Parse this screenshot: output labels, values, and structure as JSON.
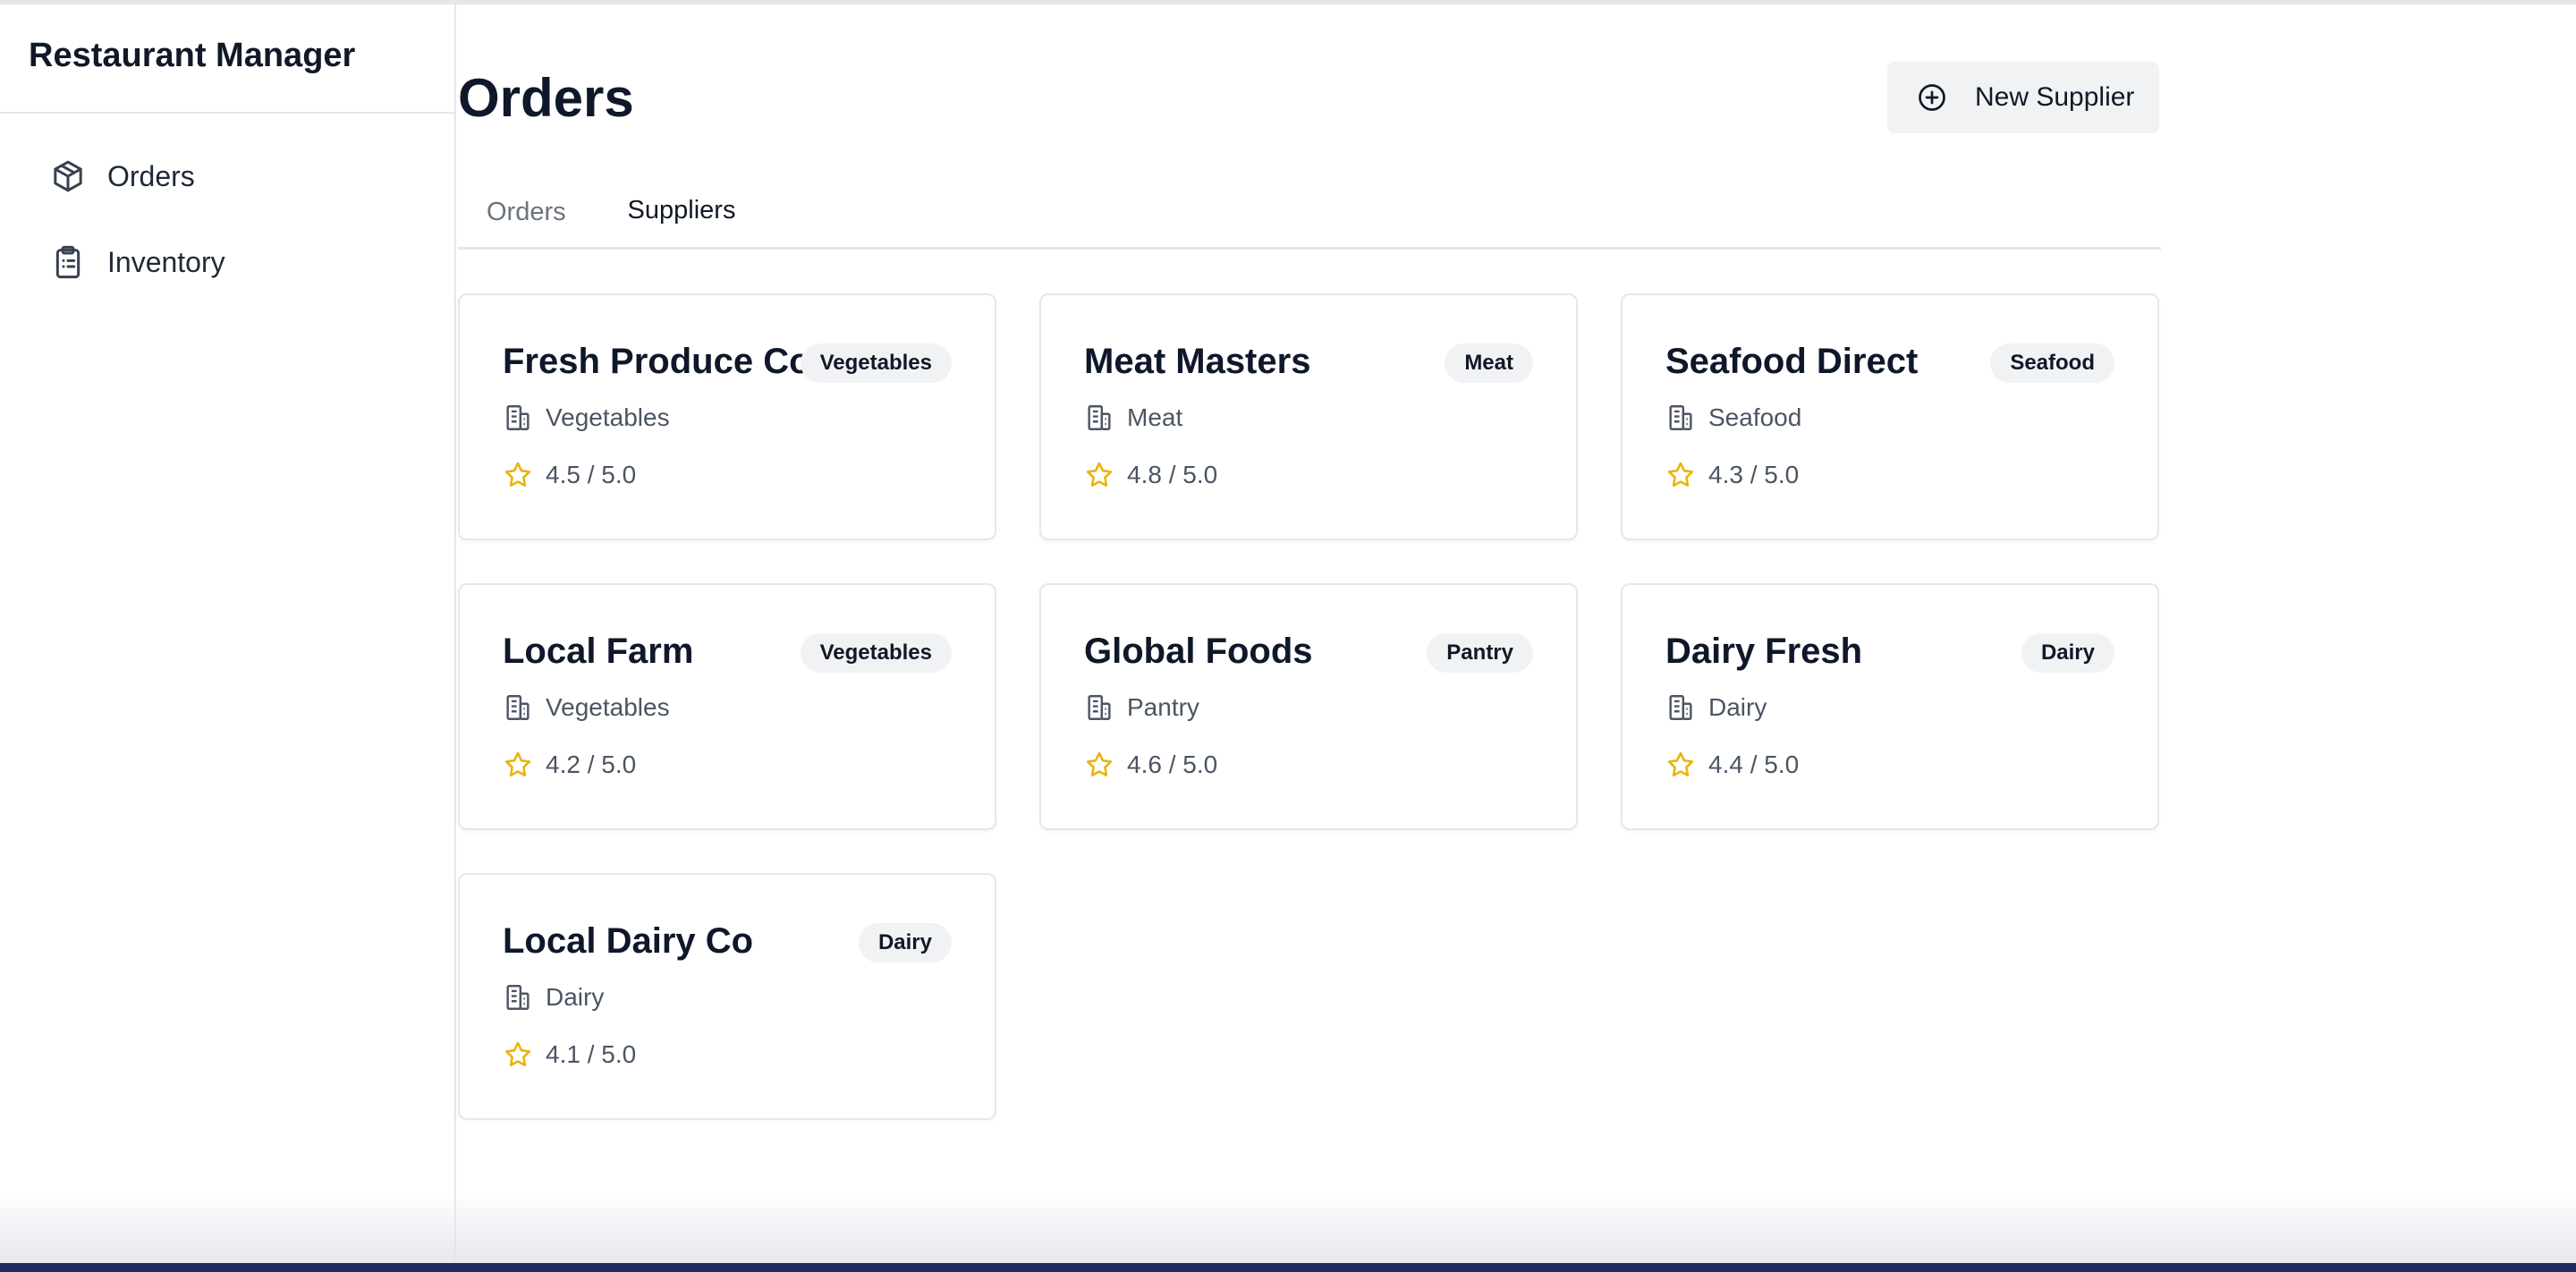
{
  "app": {
    "title": "Restaurant Manager"
  },
  "sidebar": {
    "items": [
      {
        "label": "Orders",
        "icon": "package-icon"
      },
      {
        "label": "Inventory",
        "icon": "clipboard-list-icon"
      }
    ]
  },
  "header": {
    "title": "Orders",
    "new_button_label": "New Supplier"
  },
  "tabs": [
    {
      "label": "Orders",
      "active": false
    },
    {
      "label": "Suppliers",
      "active": true
    }
  ],
  "suppliers": [
    {
      "name": "Fresh Produce Co",
      "badge": "Vegetables",
      "category": "Vegetables",
      "rating": "4.5 / 5.0"
    },
    {
      "name": "Meat Masters",
      "badge": "Meat",
      "category": "Meat",
      "rating": "4.8 / 5.0"
    },
    {
      "name": "Seafood Direct",
      "badge": "Seafood",
      "category": "Seafood",
      "rating": "4.3 / 5.0"
    },
    {
      "name": "Local Farm",
      "badge": "Vegetables",
      "category": "Vegetables",
      "rating": "4.2 / 5.0"
    },
    {
      "name": "Global Foods",
      "badge": "Pantry",
      "category": "Pantry",
      "rating": "4.6 / 5.0"
    },
    {
      "name": "Dairy Fresh",
      "badge": "Dairy",
      "category": "Dairy",
      "rating": "4.4 / 5.0"
    },
    {
      "name": "Local Dairy Co",
      "badge": "Dairy",
      "category": "Dairy",
      "rating": "4.1 / 5.0"
    }
  ],
  "colors": {
    "star": "#eab308",
    "border": "#e5e7eb",
    "badge_bg": "#f1f2f4",
    "bottom_bar": "#1e2a5c"
  }
}
